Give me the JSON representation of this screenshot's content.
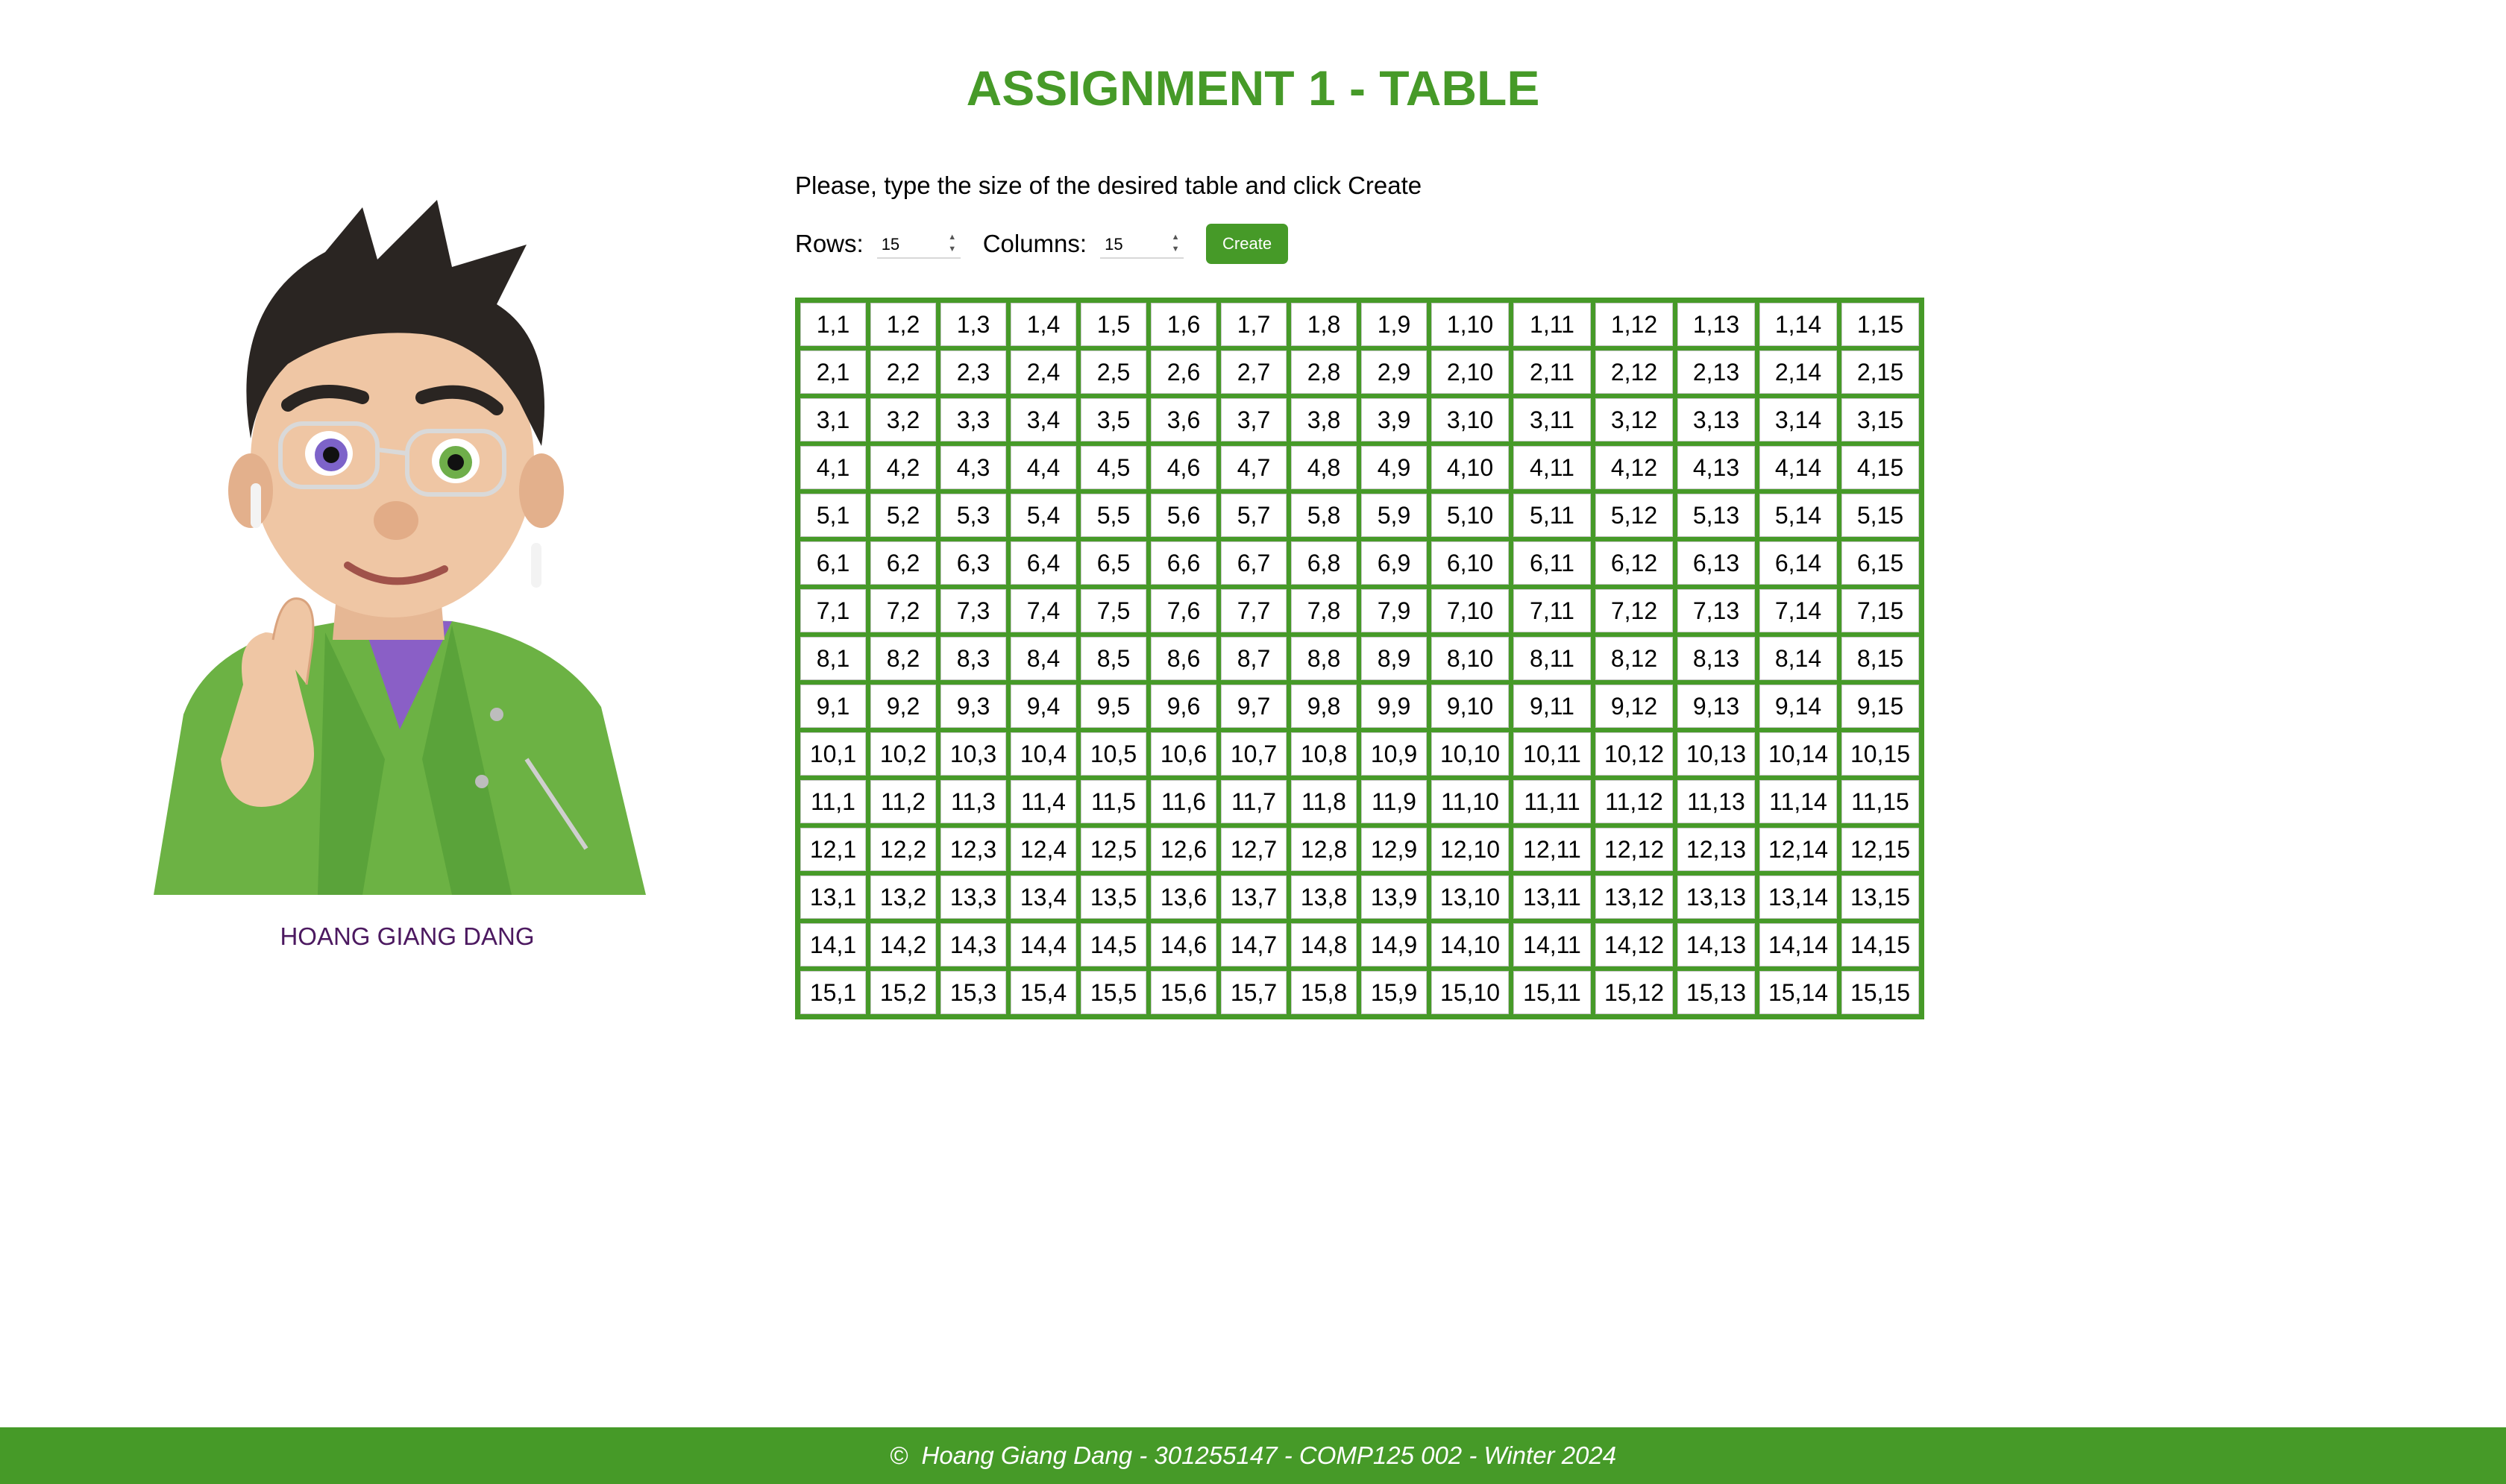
{
  "title": "ASSIGNMENT 1 - TABLE",
  "profile": {
    "name": "HOANG GIANG DANG",
    "avatar_icon": "memoji-avatar-icon"
  },
  "form": {
    "instructions": "Please, type the size of the desired table and click Create",
    "rows_label": "Rows:",
    "rows_value": "15",
    "columns_label": "Columns:",
    "columns_value": "15",
    "create_label": "Create"
  },
  "table": {
    "rows": 15,
    "columns": 15,
    "cells": [
      [
        "1,1",
        "1,2",
        "1,3",
        "1,4",
        "1,5",
        "1,6",
        "1,7",
        "1,8",
        "1,9",
        "1,10",
        "1,11",
        "1,12",
        "1,13",
        "1,14",
        "1,15"
      ],
      [
        "2,1",
        "2,2",
        "2,3",
        "2,4",
        "2,5",
        "2,6",
        "2,7",
        "2,8",
        "2,9",
        "2,10",
        "2,11",
        "2,12",
        "2,13",
        "2,14",
        "2,15"
      ],
      [
        "3,1",
        "3,2",
        "3,3",
        "3,4",
        "3,5",
        "3,6",
        "3,7",
        "3,8",
        "3,9",
        "3,10",
        "3,11",
        "3,12",
        "3,13",
        "3,14",
        "3,15"
      ],
      [
        "4,1",
        "4,2",
        "4,3",
        "4,4",
        "4,5",
        "4,6",
        "4,7",
        "4,8",
        "4,9",
        "4,10",
        "4,11",
        "4,12",
        "4,13",
        "4,14",
        "4,15"
      ],
      [
        "5,1",
        "5,2",
        "5,3",
        "5,4",
        "5,5",
        "5,6",
        "5,7",
        "5,8",
        "5,9",
        "5,10",
        "5,11",
        "5,12",
        "5,13",
        "5,14",
        "5,15"
      ],
      [
        "6,1",
        "6,2",
        "6,3",
        "6,4",
        "6,5",
        "6,6",
        "6,7",
        "6,8",
        "6,9",
        "6,10",
        "6,11",
        "6,12",
        "6,13",
        "6,14",
        "6,15"
      ],
      [
        "7,1",
        "7,2",
        "7,3",
        "7,4",
        "7,5",
        "7,6",
        "7,7",
        "7,8",
        "7,9",
        "7,10",
        "7,11",
        "7,12",
        "7,13",
        "7,14",
        "7,15"
      ],
      [
        "8,1",
        "8,2",
        "8,3",
        "8,4",
        "8,5",
        "8,6",
        "8,7",
        "8,8",
        "8,9",
        "8,10",
        "8,11",
        "8,12",
        "8,13",
        "8,14",
        "8,15"
      ],
      [
        "9,1",
        "9,2",
        "9,3",
        "9,4",
        "9,5",
        "9,6",
        "9,7",
        "9,8",
        "9,9",
        "9,10",
        "9,11",
        "9,12",
        "9,13",
        "9,14",
        "9,15"
      ],
      [
        "10,1",
        "10,2",
        "10,3",
        "10,4",
        "10,5",
        "10,6",
        "10,7",
        "10,8",
        "10,9",
        "10,10",
        "10,11",
        "10,12",
        "10,13",
        "10,14",
        "10,15"
      ],
      [
        "11,1",
        "11,2",
        "11,3",
        "11,4",
        "11,5",
        "11,6",
        "11,7",
        "11,8",
        "11,9",
        "11,10",
        "11,11",
        "11,12",
        "11,13",
        "11,14",
        "11,15"
      ],
      [
        "12,1",
        "12,2",
        "12,3",
        "12,4",
        "12,5",
        "12,6",
        "12,7",
        "12,8",
        "12,9",
        "12,10",
        "12,11",
        "12,12",
        "12,13",
        "12,14",
        "12,15"
      ],
      [
        "13,1",
        "13,2",
        "13,3",
        "13,4",
        "13,5",
        "13,6",
        "13,7",
        "13,8",
        "13,9",
        "13,10",
        "13,11",
        "13,12",
        "13,13",
        "13,14",
        "13,15"
      ],
      [
        "14,1",
        "14,2",
        "14,3",
        "14,4",
        "14,5",
        "14,6",
        "14,7",
        "14,8",
        "14,9",
        "14,10",
        "14,11",
        "14,12",
        "14,13",
        "14,14",
        "14,15"
      ],
      [
        "15,1",
        "15,2",
        "15,3",
        "15,4",
        "15,5",
        "15,6",
        "15,7",
        "15,8",
        "15,9",
        "15,10",
        "15,11",
        "15,12",
        "15,13",
        "15,14",
        "15,15"
      ]
    ]
  },
  "footer": {
    "text": "©  Hoang Giang Dang - 301255147 - COMP125 002 - Winter 2024"
  },
  "colors": {
    "accent": "#469a28",
    "name_text": "#4c1960",
    "background": "#ffffff"
  }
}
